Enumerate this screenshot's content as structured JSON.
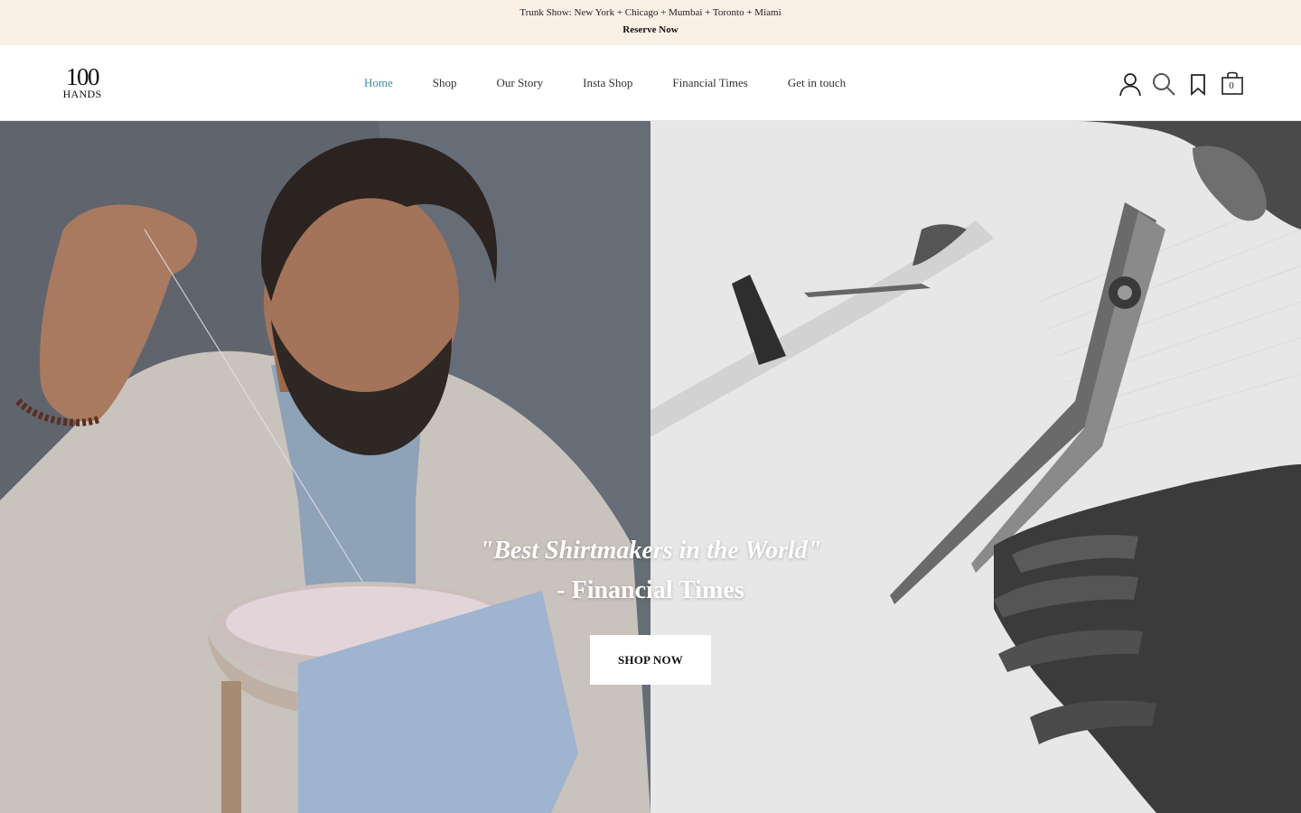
{
  "announcement": {
    "text": "Trunk Show: New York + Chicago + Mumbai + Toronto + Miami",
    "link_label": "Reserve Now"
  },
  "logo": {
    "number": "100",
    "word": "HANDS"
  },
  "nav": {
    "items": [
      {
        "label": "Home",
        "active": true
      },
      {
        "label": "Shop",
        "active": false
      },
      {
        "label": "Our Story",
        "active": false
      },
      {
        "label": "Insta Shop",
        "active": false
      },
      {
        "label": "Financial Times",
        "active": false
      },
      {
        "label": "Get in touch",
        "active": false
      }
    ],
    "active_color": "#3a8ca3"
  },
  "header_icons": {
    "account": "user-icon",
    "search": "search-icon",
    "wishlist": "bookmark-icon",
    "cart": "shopping-bag-icon",
    "cart_count": "0"
  },
  "hero": {
    "quote": "\"Best Shirtmakers in the World\"",
    "attribution": "- Financial Times",
    "cta_label": "SHOP NOW",
    "left_image": "craftsman-sewing-collar",
    "right_image": "scissors-cutting-fabric"
  },
  "colors": {
    "announcement_bg": "#faf0e6",
    "nav_active": "#3a8ca3",
    "text": "#222222"
  }
}
